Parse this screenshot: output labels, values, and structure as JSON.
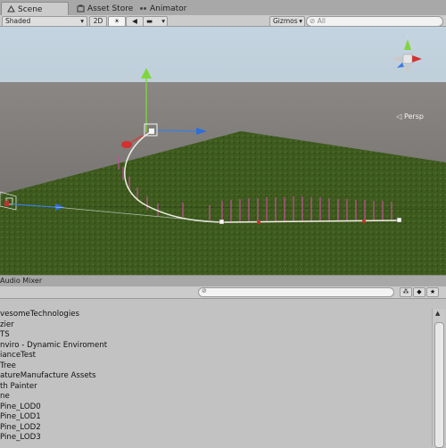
{
  "tabs": [
    {
      "label": "Scene",
      "icon": "scene-icon",
      "active": true
    },
    {
      "label": "Asset Store",
      "icon": "store-icon",
      "active": false
    },
    {
      "label": "Animator",
      "icon": "animator-icon",
      "active": false
    }
  ],
  "toolbar": {
    "shading_mode": "Shaded",
    "mode_2d": "2D",
    "gizmos": "Gizmos",
    "search_placeholder": "All"
  },
  "viewport": {
    "projection_label": "Persp",
    "colors": {
      "sky": "#c3d4e0",
      "horizon": "#7e7b78",
      "ground": "#3e5a1e",
      "spline": "#f2efe6",
      "axis_y": "#7fd63c",
      "axis_x": "#3a7fe0"
    }
  },
  "mixer": {
    "title": "Audio Mixer"
  },
  "hierarchy": {
    "items": [
      "vesomeTechnologies",
      "zier",
      "TS",
      "nviro - Dynamic Enviroment",
      "ianceTest",
      "Tree",
      "atureManufacture Assets",
      "th Painter",
      "ne",
      "Pine_LOD0",
      "Pine_LOD1",
      "Pine_LOD2",
      "Pine_LOD3"
    ]
  }
}
